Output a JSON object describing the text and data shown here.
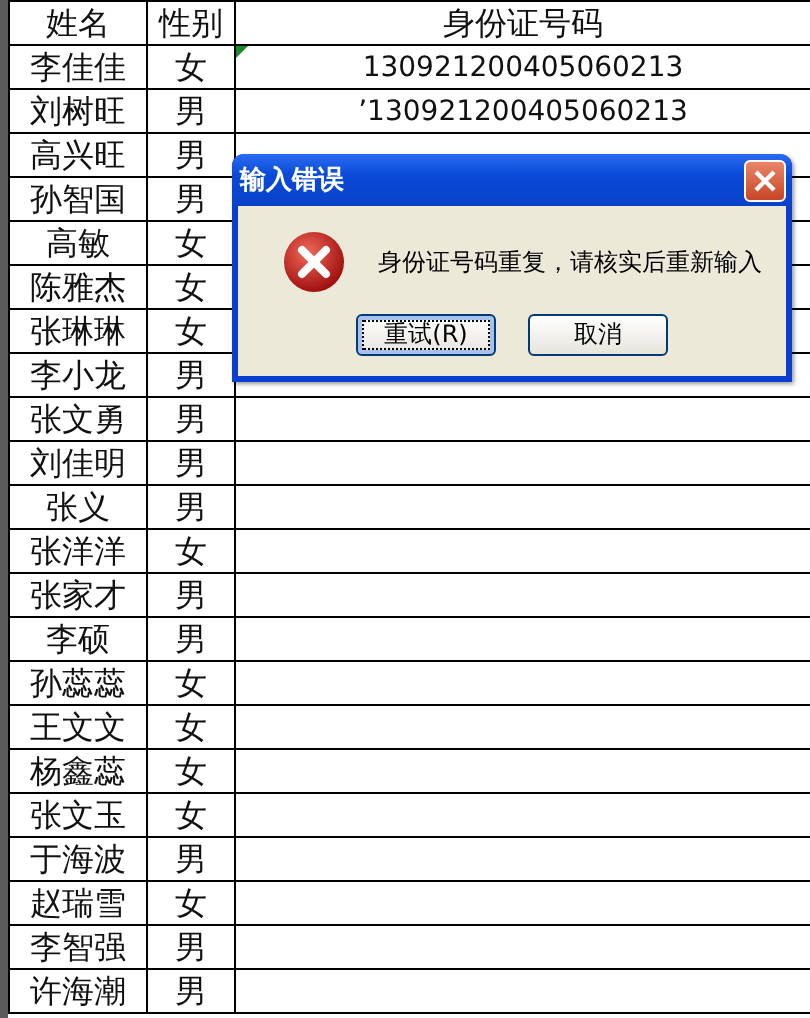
{
  "table": {
    "columns": [
      "姓名",
      "性别",
      "身份证号码"
    ],
    "rows": [
      {
        "name": "李佳佳",
        "gender": "女",
        "id": "130921200405060213",
        "error_flag": true
      },
      {
        "name": "刘树旺",
        "gender": "男",
        "id": "’130921200405060213",
        "error_flag": false
      },
      {
        "name": "高兴旺",
        "gender": "男"
      },
      {
        "name": "孙智国",
        "gender": "男"
      },
      {
        "name": "高敏",
        "gender": "女"
      },
      {
        "name": "陈雅杰",
        "gender": "女"
      },
      {
        "name": "张琳琳",
        "gender": "女"
      },
      {
        "name": "李小龙",
        "gender": "男"
      },
      {
        "name": "张文勇",
        "gender": "男"
      },
      {
        "name": "刘佳明",
        "gender": "男"
      },
      {
        "name": "张义",
        "gender": "男"
      },
      {
        "name": "张洋洋",
        "gender": "女"
      },
      {
        "name": "张家才",
        "gender": "男"
      },
      {
        "name": "李硕",
        "gender": "男"
      },
      {
        "name": "孙蕊蕊",
        "gender": "女"
      },
      {
        "name": "王文文",
        "gender": "女"
      },
      {
        "name": "杨鑫蕊",
        "gender": "女"
      },
      {
        "name": "张文玉",
        "gender": "女"
      },
      {
        "name": "于海波",
        "gender": "男"
      },
      {
        "name": "赵瑞雪",
        "gender": "女"
      },
      {
        "name": "李智强",
        "gender": "男"
      },
      {
        "name": "许海潮",
        "gender": "男"
      }
    ]
  },
  "dialog": {
    "title": "输入错误",
    "message": "身份证号码重复，请核实后重新输入",
    "buttons": [
      {
        "label": "重试(R)",
        "focused": true
      },
      {
        "label": "取消",
        "focused": false
      }
    ]
  }
}
